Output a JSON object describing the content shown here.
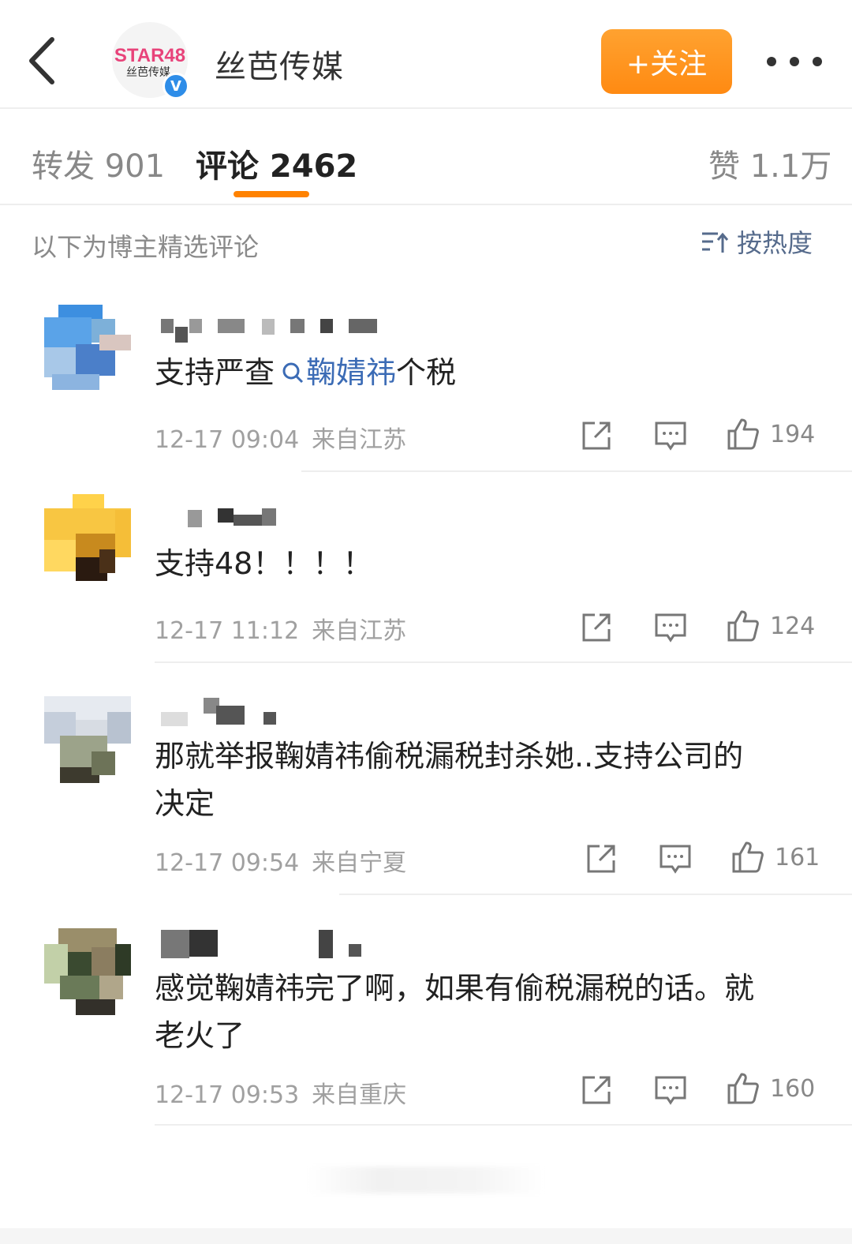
{
  "header": {
    "back_icon": "chevron-left-icon",
    "logo_text": "STAR48",
    "logo_subtext": "丝芭传媒",
    "verified_mark": "V",
    "account_name": "丝芭传媒",
    "follow_label": "+关注",
    "more_icon": "more-dots-icon",
    "accent_color": "#ff8200"
  },
  "tabs": {
    "repost": "转发 901",
    "comments": "评论 2462",
    "likes": "赞 1.1万"
  },
  "filter": {
    "note": "以下为博主精选评论",
    "sort_label": "按热度",
    "sort_icon": "sort-icon"
  },
  "comments": [
    {
      "text_before": "支持严查",
      "topic": "鞠婧祎",
      "text_after": "个税",
      "date": "12-17 09:04",
      "location": "来自江苏",
      "likes": "194"
    },
    {
      "text": "支持48！！！！",
      "date": "12-17 11:12",
      "location": "来自江苏",
      "likes": "124"
    },
    {
      "line1": "那就举报鞠婧祎偷税漏税封杀她..支持公司的",
      "line2": "决定",
      "date": "12-17 09:54",
      "location": "来自宁夏",
      "likes": "161"
    },
    {
      "line1": "感觉鞠婧祎完了啊，如果有偷税漏税的话。就",
      "line2": "老火了",
      "date": "12-17 09:53",
      "location": "来自重庆",
      "likes": "160"
    }
  ]
}
